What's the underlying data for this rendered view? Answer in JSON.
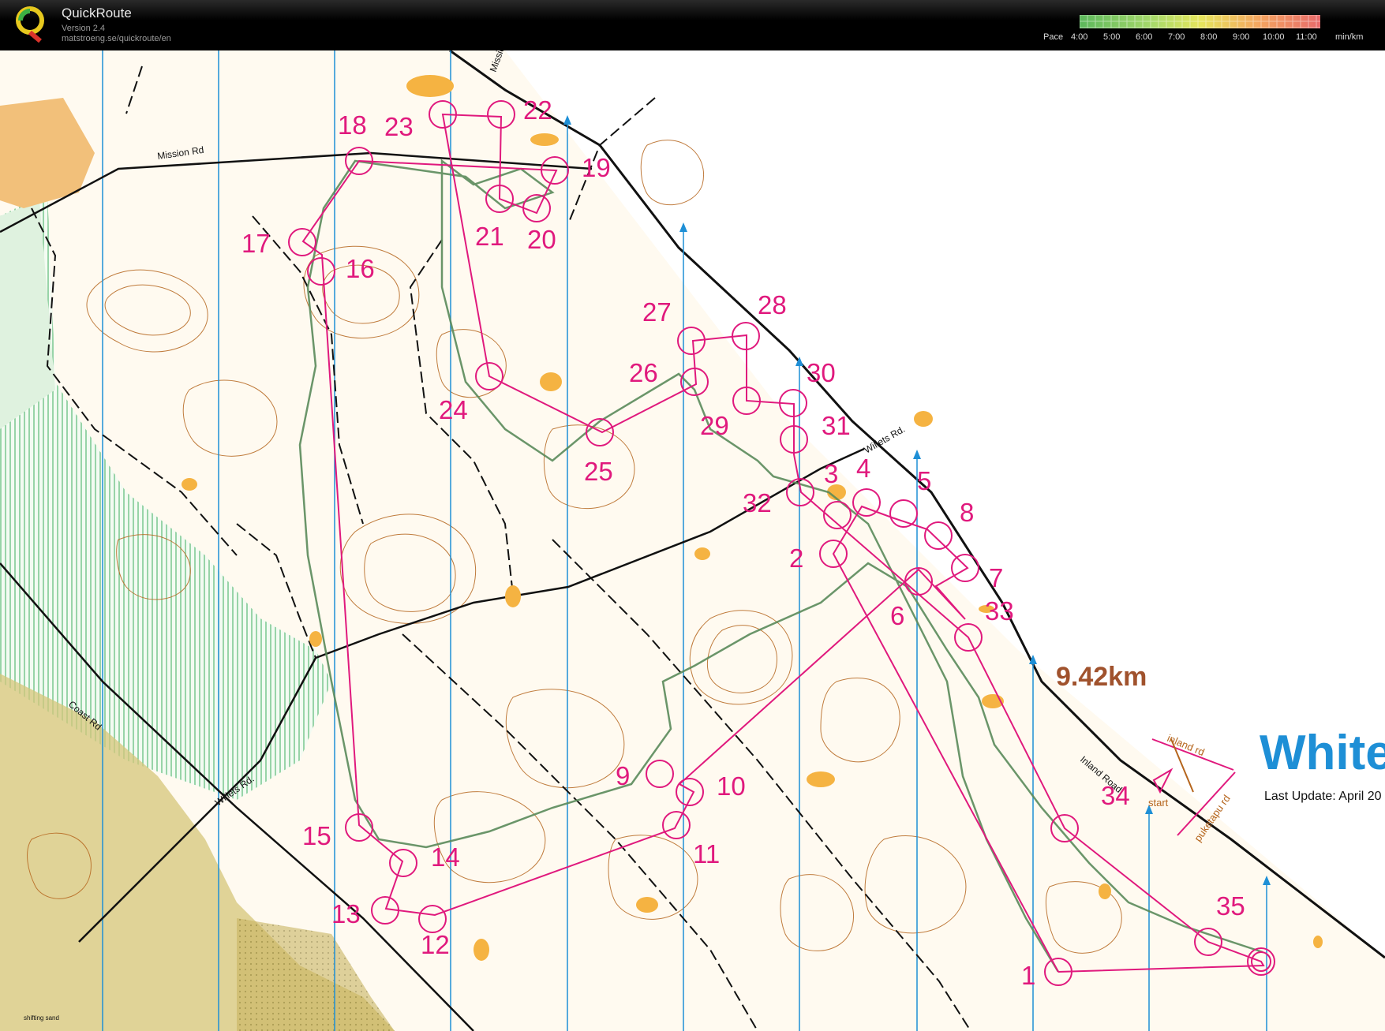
{
  "app": {
    "name": "QuickRoute",
    "version": "Version 2.4",
    "url": "matstroeng.se/quickroute/en"
  },
  "pace_scale": {
    "label": "Pace",
    "ticks": [
      "4:00",
      "5:00",
      "6:00",
      "7:00",
      "8:00",
      "9:00",
      "10:00",
      "11:00"
    ],
    "unit": "min/km",
    "colors": [
      "#5cb85c",
      "#a6d96a",
      "#e6e65c",
      "#f4a460",
      "#e86a6a"
    ]
  },
  "map": {
    "title": "White",
    "last_update": "Last Update: April 20",
    "route_distance": "9.42km",
    "roads": [
      "Mission Rd",
      "Willets Rd.",
      "Willets Rd.",
      "Coast Rd",
      "Inland Road",
      "Mission"
    ],
    "start_marks": [
      "inland rd",
      "start",
      "puketapu rd"
    ],
    "small_label": "shifting sand",
    "controls": [
      "1",
      "2",
      "3",
      "4",
      "5",
      "6",
      "7",
      "8",
      "9",
      "10",
      "11",
      "12",
      "13",
      "14",
      "15",
      "16",
      "17",
      "18",
      "19",
      "20",
      "21",
      "22",
      "23",
      "24",
      "25",
      "26",
      "27",
      "28",
      "29",
      "30",
      "31",
      "32",
      "33",
      "34",
      "35"
    ],
    "colors": {
      "course": "#e0197d",
      "route": "#5a8a5a",
      "contour": "#b5651d",
      "water_lines": "#1e8fd6",
      "open": "#f5b342",
      "vegetation": "#8fc98f",
      "title": "#1e8fd6"
    }
  }
}
